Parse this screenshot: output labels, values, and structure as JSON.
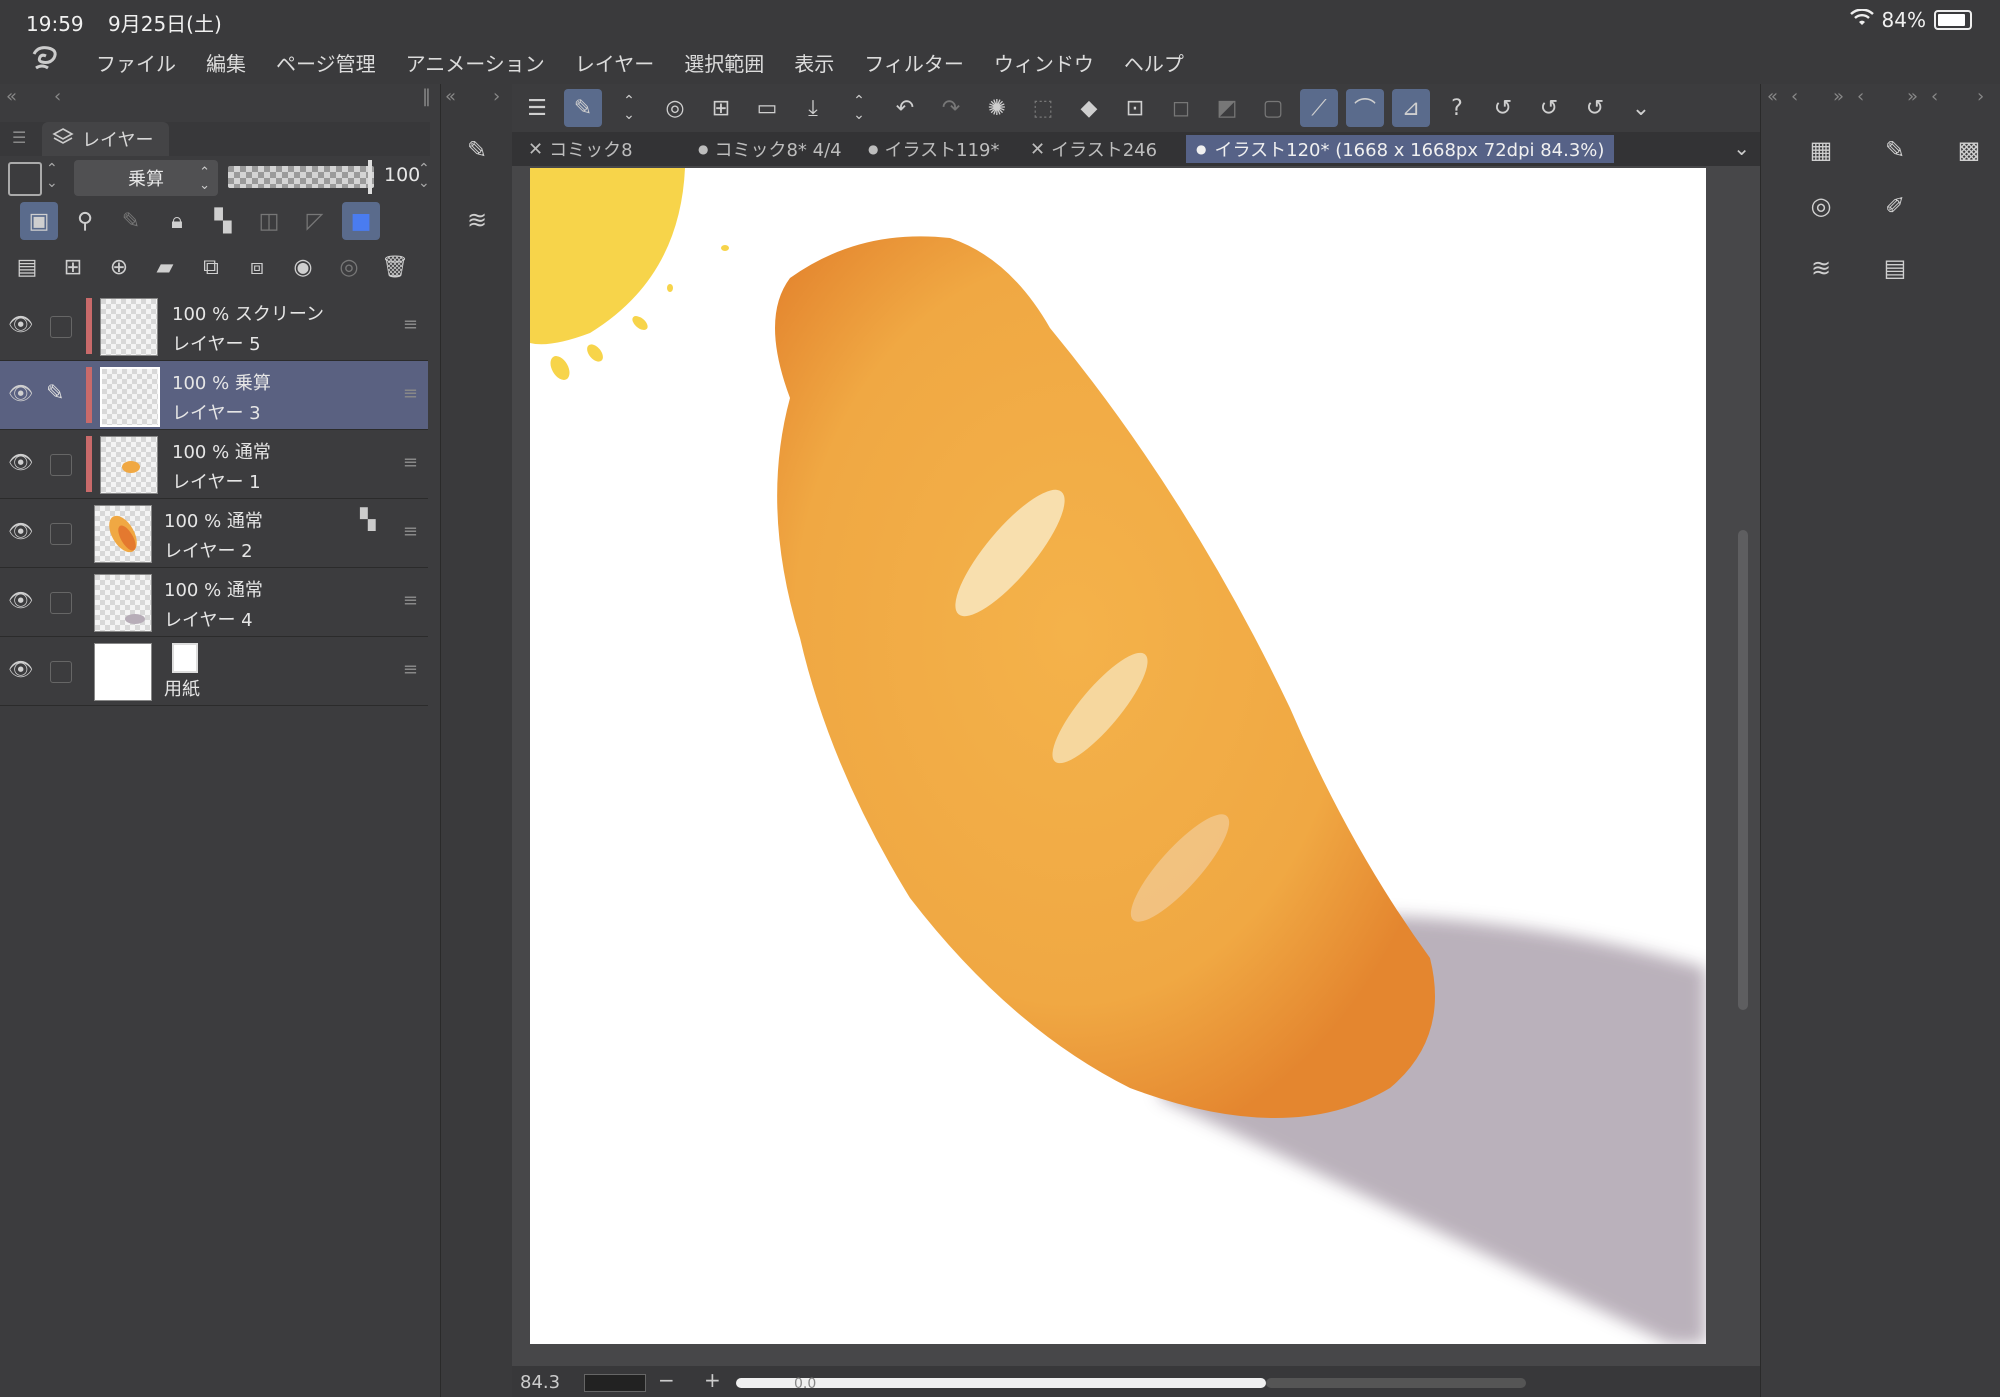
{
  "status_bar": {
    "time": "19:59",
    "date": "9月25日(土)",
    "battery": "84%"
  },
  "menu": [
    "ファイル",
    "編集",
    "ページ管理",
    "アニメーション",
    "レイヤー",
    "選択範囲",
    "表示",
    "フィルター",
    "ウィンドウ",
    "ヘルプ"
  ],
  "layer_panel": {
    "tab_label": "レイヤー",
    "blend_mode": "乗算",
    "opacity_value": "100",
    "layers": [
      {
        "mode": "100 % スクリーン",
        "name": "レイヤー 5",
        "selected": false
      },
      {
        "mode": "100 % 乗算",
        "name": "レイヤー 3",
        "selected": true
      },
      {
        "mode": "100 % 通常",
        "name": "レイヤー 1",
        "selected": false
      },
      {
        "mode": "100 % 通常",
        "name": "レイヤー 2",
        "selected": false
      },
      {
        "mode": "100 % 通常",
        "name": "レイヤー 4",
        "selected": false
      },
      {
        "mode": "",
        "name": "用紙",
        "selected": false
      }
    ]
  },
  "doc_tabs": [
    {
      "label": "コミック8",
      "prefix": "✕"
    },
    {
      "label": "コミック8* 4/4",
      "prefix": "●"
    },
    {
      "label": "イラスト119*",
      "prefix": "●"
    },
    {
      "label": "イラスト246",
      "prefix": "✕"
    },
    {
      "label": "イラスト120* (1668 x 1668px 72dpi 84.3%)",
      "prefix": "●",
      "active": true
    }
  ],
  "bottom_bar": {
    "zoom_value": "84.3",
    "minus": "−",
    "plus": "+",
    "angle_value": "0.0"
  },
  "colors": {
    "accent": "#5a6181",
    "bread": "#f0a843",
    "sun": "#f7d44a",
    "shadow": "#b7adb8"
  },
  "icons": [
    "clip-studio-logo-icon",
    "layer-stack-icon",
    "eye-icon",
    "pen-icon",
    "menu-icon",
    "undo-icon",
    "redo-icon",
    "fill-icon",
    "transform-icon",
    "navigator-icon",
    "sub-view-icon",
    "history-icon",
    "material-icon",
    "timeline-icon",
    "color-wheel-icon"
  ]
}
